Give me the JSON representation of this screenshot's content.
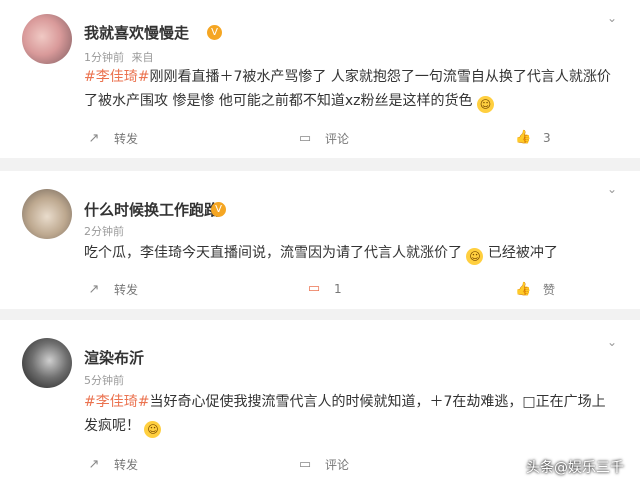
{
  "comments": [
    {
      "username": "我就喜欢慢慢走",
      "time": "1分钟前",
      "device": "来自",
      "hashtag": "#李佳琦#",
      "body": "刚刚看直播＋7被水产骂惨了 人家就抱怨了一句流雪自从换了代言人就涨价了被水产围攻 惨是惨 他可能之前都不知道xz粉丝是这样的货色",
      "repost_label": "转发",
      "comment_label": "评论",
      "like_count": "3"
    },
    {
      "username": "什么时候换工作跑路",
      "time": "2分钟前",
      "body_a": "吃个瓜，李佳琦今天直播间说，流雪因为请了代言人就涨价了",
      "body_b": "已经被冲了",
      "repost_label": "转发",
      "comment_count": "1",
      "like_label": "赞"
    },
    {
      "username": "渲染布沂",
      "time": "5分钟前",
      "hashtag": "#李佳琦#",
      "body": "当好奇心促使我搜流雪代言人的时候就知道，＋7在劫难逃，□正在广场上发疯呢！",
      "repost_label": "转发",
      "comment_label": "评论"
    }
  ],
  "watermark": "头条@娱乐三千",
  "icons": [
    "verified-badge-icon",
    "chevron-down-icon",
    "repost-icon",
    "comment-icon",
    "like-icon",
    "emoji-icon"
  ],
  "colors": {
    "hashtag": "#eb7350",
    "text": "#333333",
    "meta": "#9a9a9a",
    "badge": "#f5a623"
  }
}
